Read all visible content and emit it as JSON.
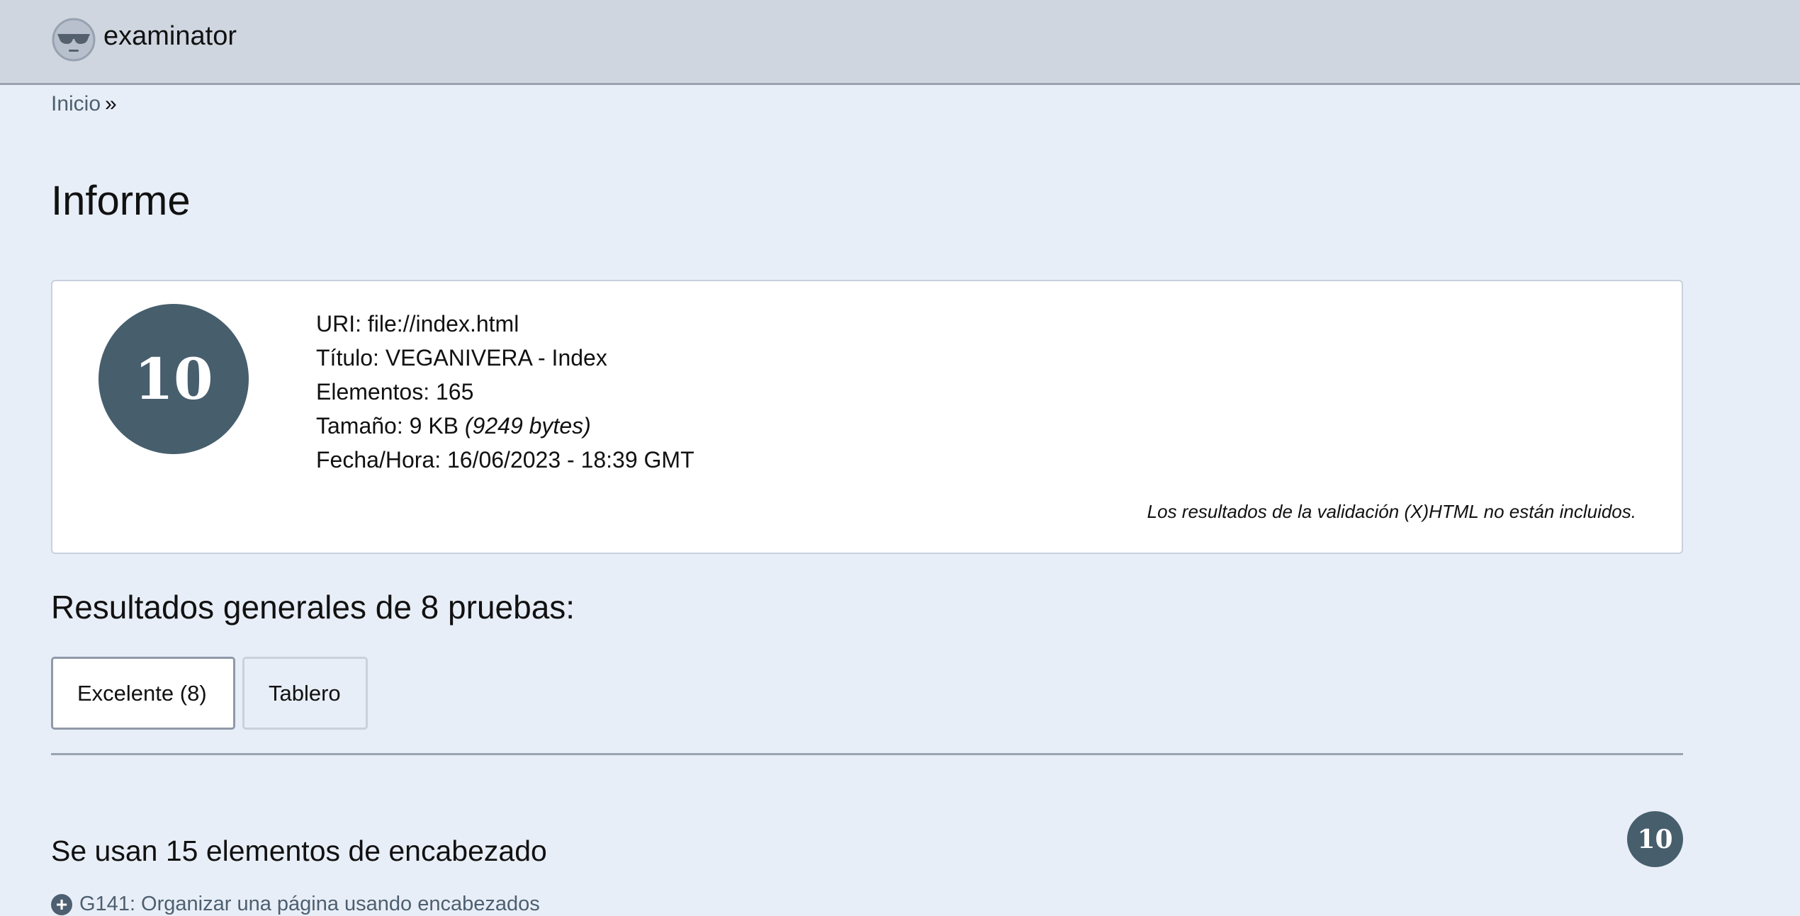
{
  "header": {
    "brand": "examinator",
    "logo_icon": "sunglasses-face-icon"
  },
  "breadcrumb": {
    "home": "Inicio",
    "separator": "»"
  },
  "page": {
    "title": "Informe"
  },
  "summary": {
    "score": "10",
    "uri_label": "URI:",
    "uri_value": "file://index.html",
    "title_label": "Título:",
    "title_value": "VEGANIVERA - Index",
    "elements_label": "Elementos:",
    "elements_value": "165",
    "size_label": "Tamaño:",
    "size_value": "9 KB",
    "size_bytes": "(9249 bytes)",
    "datetime_label": "Fecha/Hora:",
    "datetime_value": "16/06/2023 - 18:39 GMT",
    "validation_note": "Los resultados de la validación (X)HTML no están incluidos."
  },
  "results": {
    "heading": "Resultados generales de 8 pruebas:",
    "tabs": [
      {
        "label": "Excelente (8)",
        "active": true
      },
      {
        "label": "Tablero",
        "active": false
      }
    ]
  },
  "section": {
    "title": "Se usan 15 elementos de encabezado",
    "score": "10",
    "technique": "G141: Organizar una página usando encabezados",
    "technique_icon": "plus-circle-icon"
  },
  "colors": {
    "background": "#e8eef7",
    "topbar": "#cfd6e0",
    "score_badge": "#475e6d",
    "link": "#4d5f70"
  }
}
